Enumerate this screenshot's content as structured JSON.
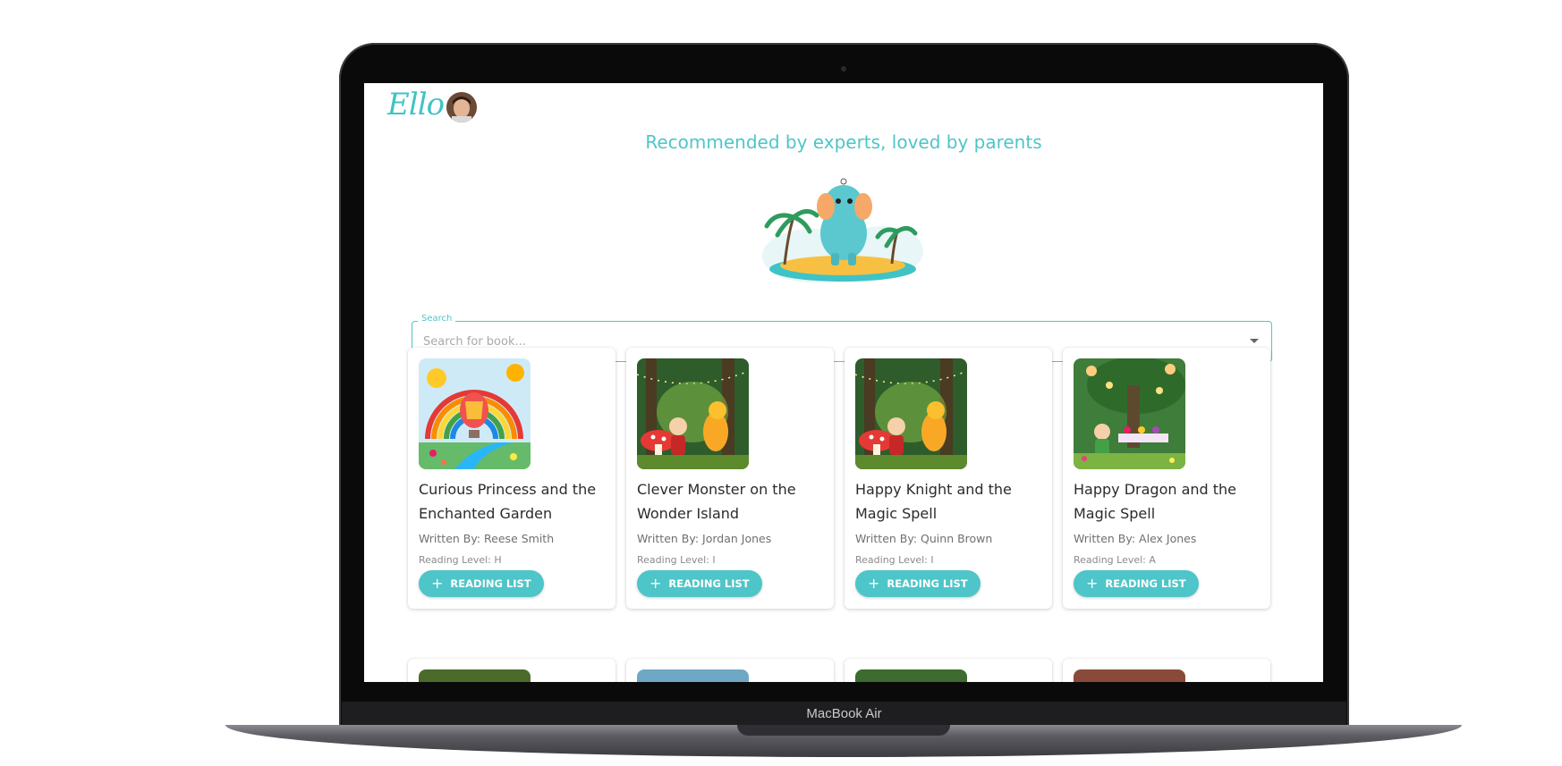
{
  "device": {
    "model_label": "MacBook Air"
  },
  "header": {
    "logo_text": "Ello",
    "headline": "Recommended by experts, loved by parents"
  },
  "search": {
    "label": "Search",
    "placeholder": "Search for book..."
  },
  "books": [
    {
      "title": "Curious Princess and the Enchanted Garden",
      "author": "Written By: Reese Smith",
      "level": "Reading Level: H",
      "button": "READING LIST",
      "cover_icon": "rainbow-balloon-cover"
    },
    {
      "title": "Clever Monster on the Wonder Island",
      "author": "Written By: Jordan Jones",
      "level": "Reading Level: I",
      "button": "READING LIST",
      "cover_icon": "forest-monster-cover"
    },
    {
      "title": "Happy Knight and the Magic Spell",
      "author": "Written By: Quinn Brown",
      "level": "Reading Level: I",
      "button": "READING LIST",
      "cover_icon": "forest-knight-cover"
    },
    {
      "title": "Happy Dragon and the Magic Spell",
      "author": "Written By: Alex Jones",
      "level": "Reading Level: A",
      "button": "READING LIST",
      "cover_icon": "garden-party-cover"
    }
  ],
  "colors": {
    "accent": "#4ec5c8",
    "text": "#2b2b2b",
    "muted": "#707070"
  }
}
